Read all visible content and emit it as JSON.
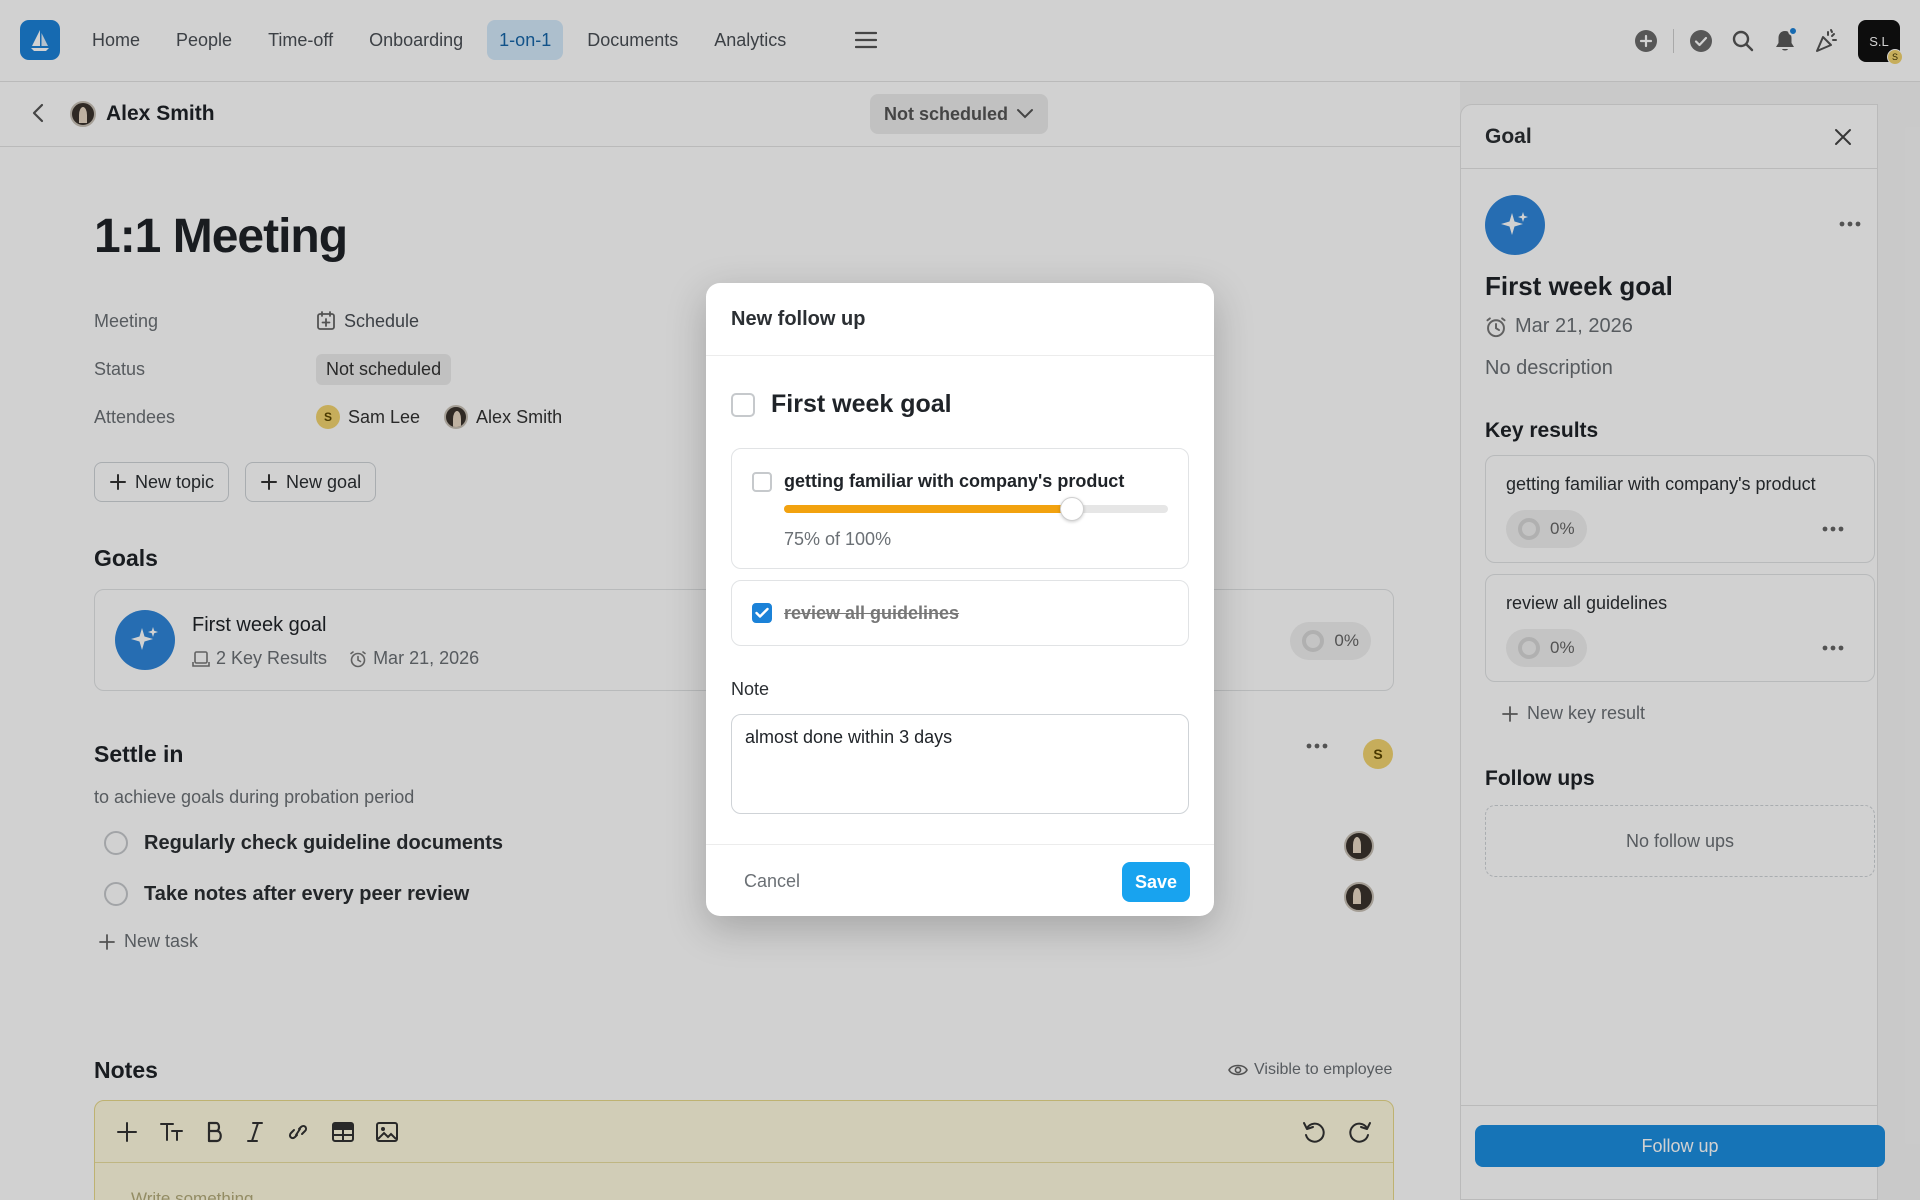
{
  "nav": {
    "items": [
      "Home",
      "People",
      "Time-off",
      "Onboarding",
      "1-on-1",
      "Documents",
      "Analytics"
    ],
    "active_index": 4,
    "user_initials": "S.L",
    "user_badge": "S"
  },
  "subheader": {
    "person_name": "Alex Smith",
    "schedule_status": "Not scheduled"
  },
  "page": {
    "title": "1:1 Meeting",
    "props": {
      "meeting_label": "Meeting",
      "meeting_value": "Schedule",
      "status_label": "Status",
      "status_value": "Not scheduled",
      "attendees_label": "Attendees",
      "attendees": [
        {
          "name": "Sam Lee",
          "initial": "S"
        },
        {
          "name": "Alex Smith"
        }
      ]
    },
    "buttons": {
      "new_topic": "New topic",
      "new_goal": "New goal"
    },
    "goals_title": "Goals",
    "goal": {
      "name": "First week goal",
      "key_results": "2 Key Results",
      "date": "Mar 21, 2026",
      "progress": "0%"
    },
    "settle": {
      "title": "Settle in",
      "description": "to achieve goals during probation period",
      "owner_initial": "S",
      "tasks": [
        "Regularly check guideline documents",
        "Take notes after every peer review"
      ],
      "new_task": "New task"
    },
    "notes": {
      "title": "Notes",
      "visibility": "Visible to employee",
      "placeholder": "Write something..."
    }
  },
  "panel": {
    "header": "Goal",
    "goal_title": "First week goal",
    "date": "Mar 21, 2026",
    "description": "No description",
    "key_results_title": "Key results",
    "key_results": [
      {
        "name": "getting familiar with company's product",
        "progress": "0%"
      },
      {
        "name": "review all guidelines",
        "progress": "0%"
      }
    ],
    "new_key_result": "New key result",
    "follow_ups_title": "Follow ups",
    "follow_ups_empty": "No follow ups",
    "follow_up_button": "Follow up"
  },
  "modal": {
    "title": "New follow up",
    "goal_name": "First week goal",
    "goal_checked": false,
    "key_results": [
      {
        "name": "getting familiar with company's product",
        "checked": false,
        "progress_percent": 75,
        "progress_text": "75% of 100%"
      },
      {
        "name": "review all guidelines",
        "checked": true
      }
    ],
    "note_label": "Note",
    "note_value": "almost done within 3 days",
    "cancel": "Cancel",
    "save": "Save"
  },
  "colors": {
    "accent": "#1b82d8",
    "save_button": "#18a3ef",
    "progress_fill": "#f2a20f",
    "notes_bg": "#fffbe0"
  }
}
